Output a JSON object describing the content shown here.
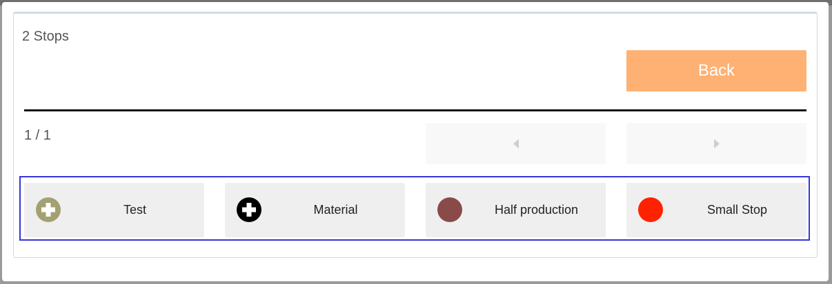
{
  "header": {
    "title": "2 Stops",
    "back_label": "Back"
  },
  "pager": {
    "text": "1 / 1",
    "prev_icon": "caret-left-icon",
    "next_icon": "caret-right-icon"
  },
  "stops": [
    {
      "label": "Test",
      "color": "#a3a172",
      "icon": "plus-circle-icon"
    },
    {
      "label": "Material",
      "color": "#000000",
      "icon": "plus-circle-icon"
    },
    {
      "label": "Half production",
      "color": "#8a4a4a",
      "icon": "circle-icon"
    },
    {
      "label": "Small Stop",
      "color": "#ff2200",
      "icon": "circle-icon"
    }
  ],
  "colors": {
    "back_button": "#ffb173",
    "selection_border": "#3535d6",
    "tile_background": "#efefef"
  }
}
